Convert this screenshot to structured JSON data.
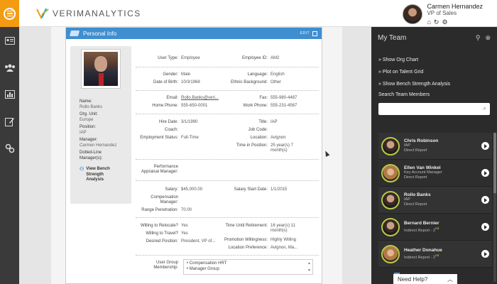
{
  "header": {
    "logo_text": "VERIMANALYTICS",
    "user_name": "Carmen Hernandez",
    "user_role": "VP of Sales"
  },
  "card": {
    "title": "Personal Info",
    "edit_label": "EDIT"
  },
  "profile": {
    "name_label": "Name:",
    "name": "Rollo Banks",
    "org_label": "Org. Unit:",
    "org": "Europe",
    "position_label": "Position:",
    "position": "IAP",
    "manager_label": "Manager:",
    "manager": "Carmen Hernandez",
    "dotted_label": "Dotted-Line Manager(s):",
    "bench_link": "View Bench Strength Analysis"
  },
  "fields": {
    "user_type_label": "User Type:",
    "user_type": "Employee",
    "employee_id_label": "Employee ID:",
    "employee_id": "AM2",
    "gender_label": "Gender:",
    "gender": "Male",
    "language_label": "Language:",
    "language": "English",
    "dob_label": "Date of Birth:",
    "dob": "10/3/1968",
    "ethnic_label": "Ethnic Background:",
    "ethnic": "Other",
    "email_label": "Email:",
    "email": "Rollo.Banks@veri...",
    "fax_label": "Fax:",
    "fax": "555-980-4487",
    "home_phone_label": "Home Phone:",
    "home_phone": "555-650-0001",
    "work_phone_label": "Work Phone:",
    "work_phone": "555-231-4567",
    "hire_label": "Hire Date:",
    "hire": "3/1/1990",
    "title_label": "Title:",
    "title": "IAP",
    "coach_label": "Coach:",
    "coach": "",
    "job_code_label": "Job Code:",
    "job_code": "",
    "emp_status_label": "Employment Status:",
    "emp_status": "Full-Time",
    "location_label": "Location:",
    "location": "Avignon",
    "time_pos_label": "Time in Position:",
    "time_pos": "25 year(s) 7 month(s)",
    "appraisal_label": "Performance Appraisal Manager:",
    "appraisal": "",
    "salary_label": "Salary:",
    "salary": "$45,000.00",
    "salary_start_label": "Salary Start Date:",
    "salary_start": "1/1/2015",
    "comp_mgr_label": "Compensation Manager:",
    "comp_mgr": "",
    "range_pen_label": "Range Penetration:",
    "range_pen": "70.00",
    "relocate_label": "Willing to Relocate?",
    "relocate": "Yes",
    "travel_label": "Willing to Travel?",
    "travel": "Yes",
    "desired_label": "Desired Position:",
    "desired": "President, VP of...",
    "retire_label": "Time Until Retirement:",
    "retire": "16 year(s) 11 month(s)",
    "promo_label": "Promotion Willingness:",
    "promo": "Highly Willing",
    "loc_pref_label": "Location Preference:",
    "loc_pref": "Avignon, Ma...",
    "group_label": "User Group Membership:",
    "groups": [
      "Compensation HRT",
      "Manager Group"
    ]
  },
  "team": {
    "title": "My Team",
    "links": [
      "» Show Org Chart",
      "» Plot on Talent Grid",
      "» Show Bench Strength Analysis"
    ],
    "search_label": "Search Team Members",
    "members": [
      {
        "name": "Chris Robinson",
        "line1": "IAP",
        "line2": "Direct Report"
      },
      {
        "name": "Ellen Van Winkel",
        "line1": "Key Account Manager",
        "line2": "Direct Report"
      },
      {
        "name": "Rollo Banks",
        "line1": "IAP",
        "line2": "Direct Report"
      },
      {
        "name": "Bernard Bernier",
        "line1": "Indirect Report - 2",
        "sup": "nd"
      },
      {
        "name": "Heather Donahue",
        "line1": "Indirect Report - 2",
        "sup": "nd"
      }
    ]
  },
  "help": {
    "label": "Need Help?"
  }
}
